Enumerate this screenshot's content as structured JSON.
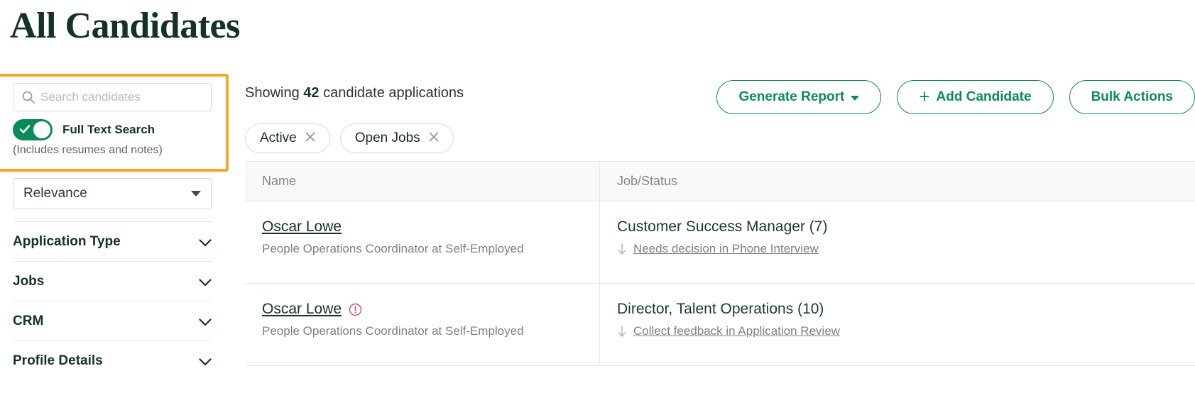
{
  "page": {
    "title": "All Candidates"
  },
  "sidebar": {
    "search": {
      "placeholder": "Search candidates",
      "value": "",
      "icon": "search-icon"
    },
    "full_text_search": {
      "label": "Full Text Search",
      "hint": "(Includes resumes and notes)",
      "enabled": true,
      "on_color": "#0b8a5a"
    },
    "highlight_color": "#f5a623",
    "sort": {
      "value": "Relevance",
      "icon": "caret-down-icon"
    },
    "filters": [
      {
        "label": "Application Type",
        "icon": "chevron-down-icon"
      },
      {
        "label": "Jobs",
        "icon": "chevron-down-icon"
      },
      {
        "label": "CRM",
        "icon": "chevron-down-icon"
      },
      {
        "label": "Profile Details",
        "icon": "chevron-down-icon"
      }
    ]
  },
  "main": {
    "showing_prefix": "Showing ",
    "showing_count": "42",
    "showing_suffix": " candidate applications",
    "buttons": [
      {
        "label": "Generate Report",
        "icon": "caret-down-icon",
        "accent": "#0b8a5a"
      },
      {
        "label": "Add Candidate",
        "icon": "plus-icon",
        "accent": "#0b8a5a"
      },
      {
        "label": "Bulk Actions",
        "icon": "",
        "accent": "#0b8a5a"
      }
    ],
    "chips": [
      {
        "label": "Active",
        "icon": "close-icon"
      },
      {
        "label": "Open Jobs",
        "icon": "close-icon"
      }
    ],
    "table": {
      "columns": [
        "Name",
        "Job/Status"
      ],
      "rows": [
        {
          "name": "Oscar Lowe",
          "subtitle": "People Operations Coordinator at Self-Employed",
          "alert": false,
          "job": "Customer Success Manager (7)",
          "status": "Needs decision in Phone Interview",
          "status_icon": "arrow-down-icon"
        },
        {
          "name": "Oscar Lowe",
          "subtitle": "People Operations Coordinator at Self-Employed",
          "alert": true,
          "alert_icon": "alert-circle-icon",
          "alert_color": "#e0456b",
          "job": "Director, Talent Operations (10)",
          "status": "Collect feedback in Application Review",
          "status_icon": "arrow-down-icon"
        }
      ]
    }
  }
}
